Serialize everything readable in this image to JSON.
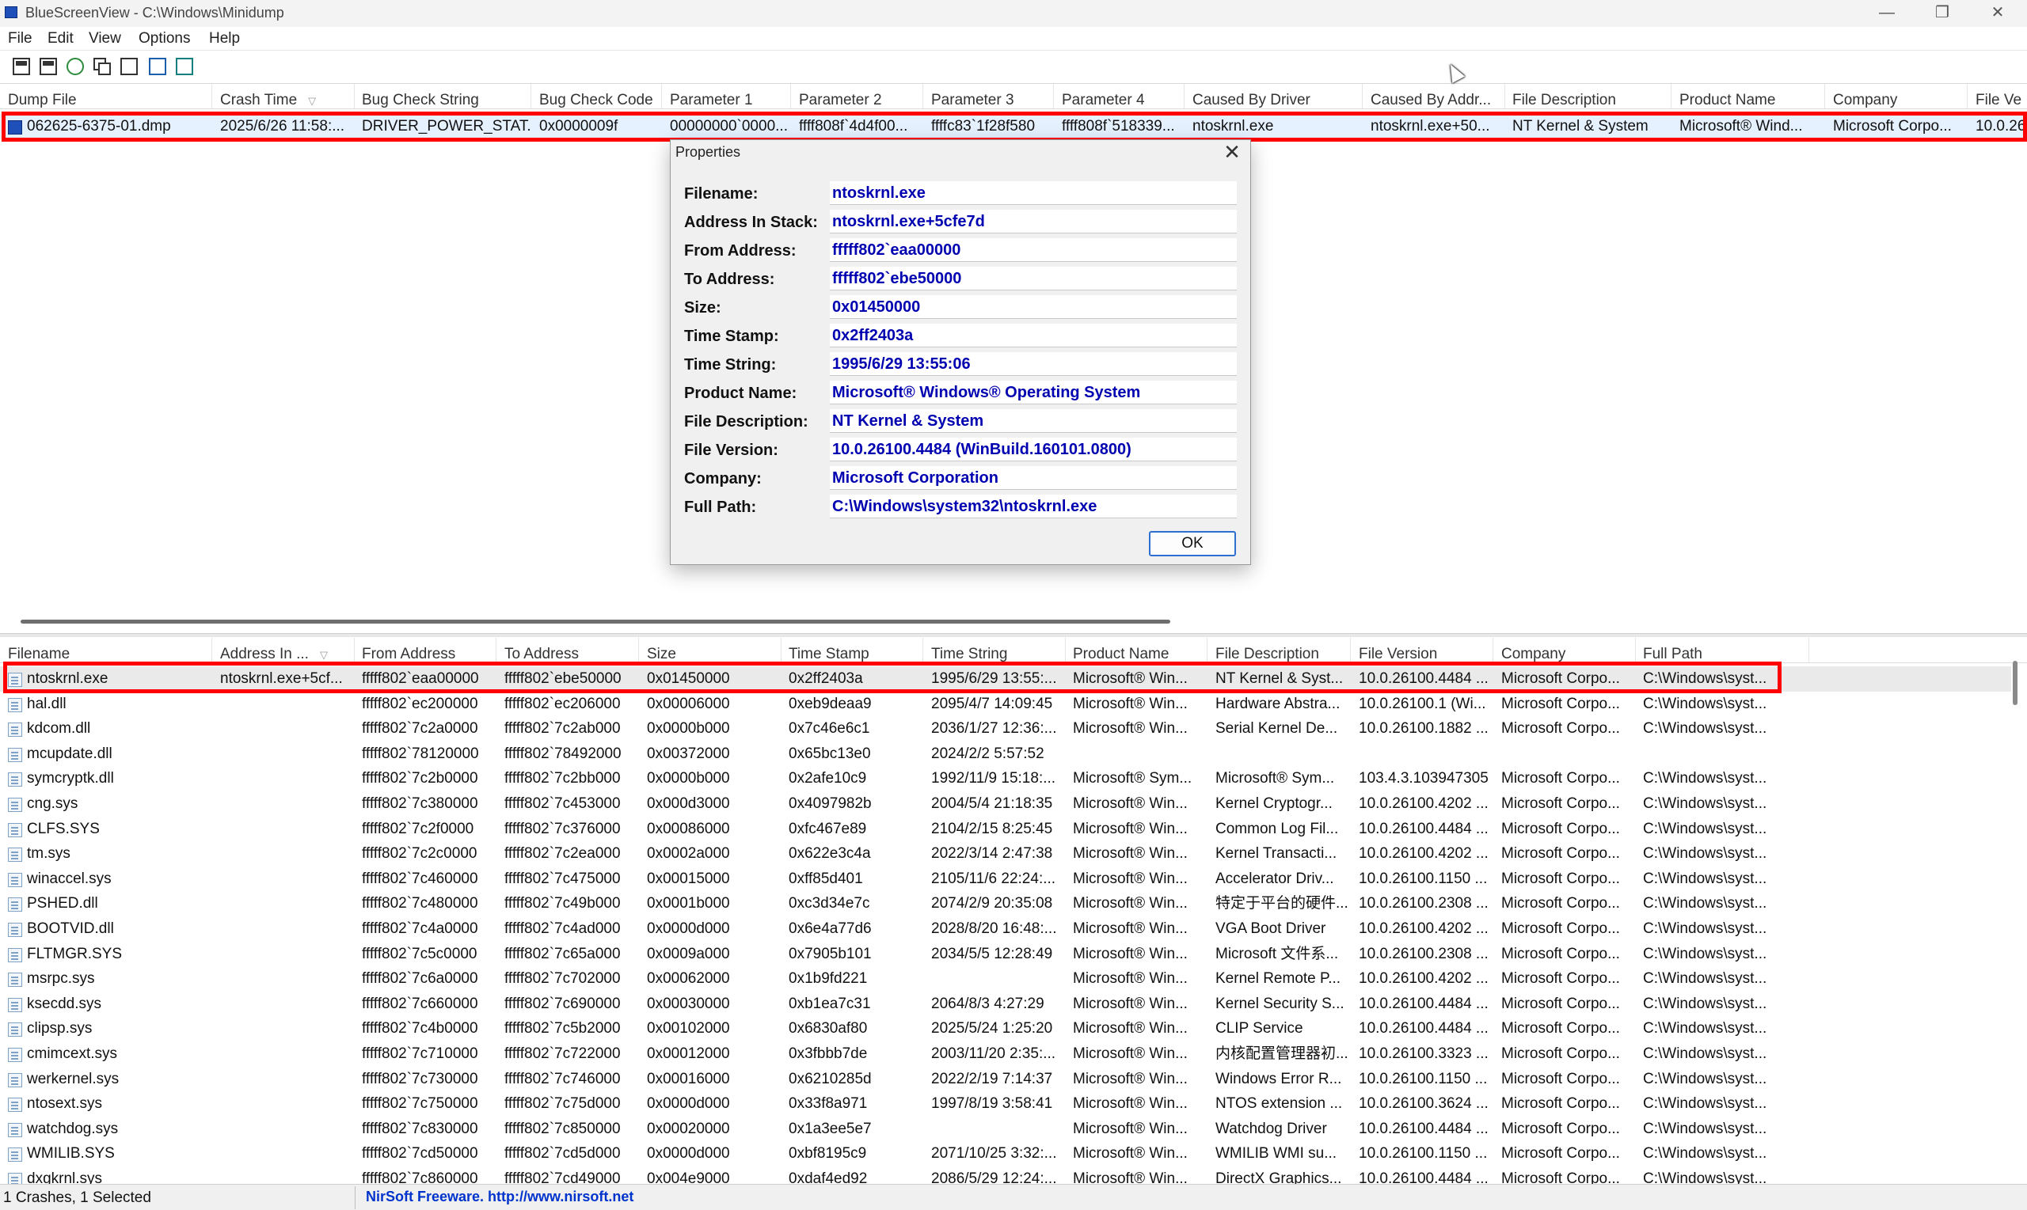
{
  "window": {
    "title": "BlueScreenView  -  C:\\Windows\\Minidump",
    "minimize": "—",
    "restore": "❐",
    "close": "✕"
  },
  "menu": [
    "File",
    "Edit",
    "View",
    "Options",
    "Help"
  ],
  "toolbar_icons": [
    "properties-icon",
    "save-icon",
    "refresh-icon",
    "copy-icon",
    "options-icon",
    "find-icon",
    "exit-icon"
  ],
  "top_table": {
    "columns": [
      "Dump File",
      "Crash Time",
      "Bug Check String",
      "Bug Check Code",
      "Parameter 1",
      "Parameter 2",
      "Parameter 3",
      "Parameter 4",
      "Caused By Driver",
      "Caused By Addr...",
      "File Description",
      "Product Name",
      "Company",
      "File Ve"
    ],
    "sorted_column": "Crash Time",
    "rows": [
      [
        "062625-6375-01.dmp",
        "2025/6/26 11:58:...",
        "DRIVER_POWER_STAT...",
        "0x0000009f",
        "00000000`0000...",
        "ffff808f`4d4f00...",
        "ffffc83`1f28f580",
        "ffff808f`518339...",
        "ntoskrnl.exe",
        "ntoskrnl.exe+50...",
        "NT Kernel & System",
        "Microsoft® Wind...",
        "Microsoft Corpo...",
        "10.0.26"
      ]
    ]
  },
  "bottom_table": {
    "columns": [
      "Filename",
      "Address In ...",
      "From Address",
      "To Address",
      "Size",
      "Time Stamp",
      "Time String",
      "Product Name",
      "File Description",
      "File Version",
      "Company",
      "Full Path"
    ],
    "sorted_column": "Address In ...",
    "rows": [
      [
        "ntoskrnl.exe",
        "ntoskrnl.exe+5cf...",
        "fffff802`eaa00000",
        "fffff802`ebe50000",
        "0x01450000",
        "0x2ff2403a",
        "1995/6/29 13:55:...",
        "Microsoft® Win...",
        "NT Kernel & Syst...",
        "10.0.26100.4484 ...",
        "Microsoft Corpo...",
        "C:\\Windows\\syst..."
      ],
      [
        "hal.dll",
        "",
        "fffff802`ec200000",
        "fffff802`ec206000",
        "0x00006000",
        "0xeb9deaa9",
        "2095/4/7 14:09:45",
        "Microsoft® Win...",
        "Hardware Abstra...",
        "10.0.26100.1 (Wi...",
        "Microsoft Corpo...",
        "C:\\Windows\\syst..."
      ],
      [
        "kdcom.dll",
        "",
        "fffff802`7c2a0000",
        "fffff802`7c2ab000",
        "0x0000b000",
        "0x7c46e6c1",
        "2036/1/27 12:36:...",
        "Microsoft® Win...",
        "Serial Kernel De...",
        "10.0.26100.1882 ...",
        "Microsoft Corpo...",
        "C:\\Windows\\syst..."
      ],
      [
        "mcupdate.dll",
        "",
        "fffff802`78120000",
        "fffff802`78492000",
        "0x00372000",
        "0x65bc13e0",
        "2024/2/2 5:57:52",
        "",
        "",
        "",
        "",
        ""
      ],
      [
        "symcryptk.dll",
        "",
        "fffff802`7c2b0000",
        "fffff802`7c2bb000",
        "0x0000b000",
        "0x2afe10c9",
        "1992/11/9 15:18:...",
        "Microsoft® Sym...",
        "Microsoft® Sym...",
        "103.4.3.103947305",
        "Microsoft Corpo...",
        "C:\\Windows\\syst..."
      ],
      [
        "cng.sys",
        "",
        "fffff802`7c380000",
        "fffff802`7c453000",
        "0x000d3000",
        "0x4097982b",
        "2004/5/4 21:18:35",
        "Microsoft® Win...",
        "Kernel Cryptogr...",
        "10.0.26100.4202 ...",
        "Microsoft Corpo...",
        "C:\\Windows\\syst..."
      ],
      [
        "CLFS.SYS",
        "",
        "fffff802`7c2f0000",
        "fffff802`7c376000",
        "0x00086000",
        "0xfc467e89",
        "2104/2/15 8:25:45",
        "Microsoft® Win...",
        "Common Log Fil...",
        "10.0.26100.4484 ...",
        "Microsoft Corpo...",
        "C:\\Windows\\syst..."
      ],
      [
        "tm.sys",
        "",
        "fffff802`7c2c0000",
        "fffff802`7c2ea000",
        "0x0002a000",
        "0x622e3c4a",
        "2022/3/14 2:47:38",
        "Microsoft® Win...",
        "Kernel Transacti...",
        "10.0.26100.4202 ...",
        "Microsoft Corpo...",
        "C:\\Windows\\syst..."
      ],
      [
        "winaccel.sys",
        "",
        "fffff802`7c460000",
        "fffff802`7c475000",
        "0x00015000",
        "0xff85d401",
        "2105/11/6 22:24:...",
        "Microsoft® Win...",
        "Accelerator Driv...",
        "10.0.26100.1150 ...",
        "Microsoft Corpo...",
        "C:\\Windows\\syst..."
      ],
      [
        "PSHED.dll",
        "",
        "fffff802`7c480000",
        "fffff802`7c49b000",
        "0x0001b000",
        "0xc3d34e7c",
        "2074/2/9 20:35:08",
        "Microsoft® Win...",
        "特定于平台的硬件...",
        "10.0.26100.2308 ...",
        "Microsoft Corpo...",
        "C:\\Windows\\syst..."
      ],
      [
        "BOOTVID.dll",
        "",
        "fffff802`7c4a0000",
        "fffff802`7c4ad000",
        "0x0000d000",
        "0x6e4a77d6",
        "2028/8/20 16:48:...",
        "Microsoft® Win...",
        "VGA Boot Driver",
        "10.0.26100.4202 ...",
        "Microsoft Corpo...",
        "C:\\Windows\\syst..."
      ],
      [
        "FLTMGR.SYS",
        "",
        "fffff802`7c5c0000",
        "fffff802`7c65a000",
        "0x0009a000",
        "0x7905b101",
        "2034/5/5 12:28:49",
        "Microsoft® Win...",
        "Microsoft 文件系...",
        "10.0.26100.2308 ...",
        "Microsoft Corpo...",
        "C:\\Windows\\syst..."
      ],
      [
        "msrpc.sys",
        "",
        "fffff802`7c6a0000",
        "fffff802`7c702000",
        "0x00062000",
        "0x1b9fd221",
        "",
        "Microsoft® Win...",
        "Kernel Remote P...",
        "10.0.26100.4202 ...",
        "Microsoft Corpo...",
        "C:\\Windows\\syst..."
      ],
      [
        "ksecdd.sys",
        "",
        "fffff802`7c660000",
        "fffff802`7c690000",
        "0x00030000",
        "0xb1ea7c31",
        "2064/8/3 4:27:29",
        "Microsoft® Win...",
        "Kernel Security S...",
        "10.0.26100.4484 ...",
        "Microsoft Corpo...",
        "C:\\Windows\\syst..."
      ],
      [
        "clipsp.sys",
        "",
        "fffff802`7c4b0000",
        "fffff802`7c5b2000",
        "0x00102000",
        "0x6830af80",
        "2025/5/24 1:25:20",
        "Microsoft® Win...",
        "CLIP Service",
        "10.0.26100.4484 ...",
        "Microsoft Corpo...",
        "C:\\Windows\\syst..."
      ],
      [
        "cmimcext.sys",
        "",
        "fffff802`7c710000",
        "fffff802`7c722000",
        "0x00012000",
        "0x3fbbb7de",
        "2003/11/20 2:35:...",
        "Microsoft® Win...",
        "内核配置管理器初...",
        "10.0.26100.3323 ...",
        "Microsoft Corpo...",
        "C:\\Windows\\syst..."
      ],
      [
        "werkernel.sys",
        "",
        "fffff802`7c730000",
        "fffff802`7c746000",
        "0x00016000",
        "0x6210285d",
        "2022/2/19 7:14:37",
        "Microsoft® Win...",
        "Windows Error R...",
        "10.0.26100.1150 ...",
        "Microsoft Corpo...",
        "C:\\Windows\\syst..."
      ],
      [
        "ntosext.sys",
        "",
        "fffff802`7c750000",
        "fffff802`7c75d000",
        "0x0000d000",
        "0x33f8a971",
        "1997/8/19 3:58:41",
        "Microsoft® Win...",
        "NTOS extension ...",
        "10.0.26100.3624 ...",
        "Microsoft Corpo...",
        "C:\\Windows\\syst..."
      ],
      [
        "watchdog.sys",
        "",
        "fffff802`7c830000",
        "fffff802`7c850000",
        "0x00020000",
        "0x1a3ee5e7",
        "",
        "Microsoft® Win...",
        "Watchdog Driver",
        "10.0.26100.4484 ...",
        "Microsoft Corpo...",
        "C:\\Windows\\syst..."
      ],
      [
        "WMILIB.SYS",
        "",
        "fffff802`7cd50000",
        "fffff802`7cd5d000",
        "0x0000d000",
        "0xbf8195c9",
        "2071/10/25 3:32:...",
        "Microsoft® Win...",
        "WMILIB WMI su...",
        "10.0.26100.1150 ...",
        "Microsoft Corpo...",
        "C:\\Windows\\syst..."
      ],
      [
        "dxgkrnl.sys",
        "",
        "fffff802`7c860000",
        "fffff802`7cd49000",
        "0x004e9000",
        "0xdaf4ed92",
        "2086/5/29 12:24:...",
        "Microsoft® Win...",
        "DirectX Graphics...",
        "10.0.26100.4484 ...",
        "Microsoft Corpo...",
        "C:\\Windows\\syst..."
      ]
    ]
  },
  "dialog": {
    "title": "Properties",
    "close": "✕",
    "ok_label": "OK",
    "fields": [
      {
        "label": "Filename:",
        "value": "ntoskrnl.exe"
      },
      {
        "label": "Address In Stack:",
        "value": "ntoskrnl.exe+5cfe7d"
      },
      {
        "label": "From Address:",
        "value": "fffff802`eaa00000"
      },
      {
        "label": "To Address:",
        "value": "fffff802`ebe50000"
      },
      {
        "label": "Size:",
        "value": "0x01450000"
      },
      {
        "label": "Time Stamp:",
        "value": "0x2ff2403a"
      },
      {
        "label": "Time String:",
        "value": "1995/6/29 13:55:06"
      },
      {
        "label": "Product Name:",
        "value": "Microsoft® Windows® Operating System"
      },
      {
        "label": "File Description:",
        "value": "NT Kernel & System"
      },
      {
        "label": "File Version:",
        "value": "10.0.26100.4484 (WinBuild.160101.0800)"
      },
      {
        "label": "Company:",
        "value": "Microsoft Corporation"
      },
      {
        "label": "Full Path:",
        "value": "C:\\Windows\\system32\\ntoskrnl.exe"
      }
    ]
  },
  "status": {
    "selection": "1 Crashes, 1 Selected",
    "credit": "NirSoft Freeware.  http://www.nirsoft.net"
  },
  "colors": {
    "highlight_box": "#ff0000",
    "dialog_value_text": "#0000b0",
    "credit_link": "#0033cc",
    "top_selected_row": "#e5f1ff"
  }
}
